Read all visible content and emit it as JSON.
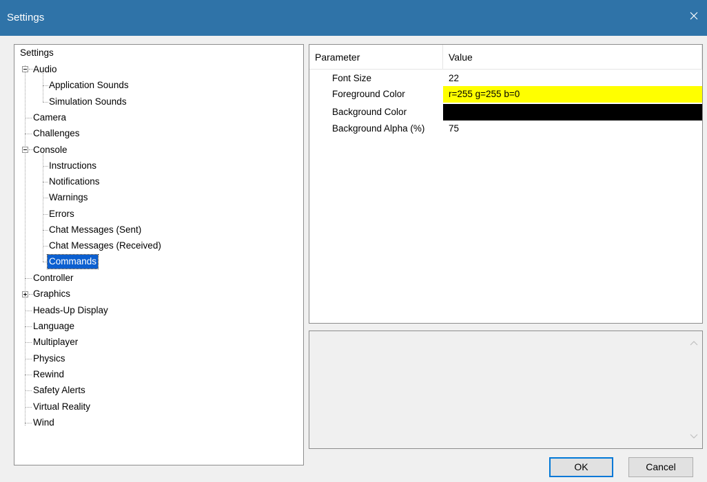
{
  "window": {
    "title": "Settings"
  },
  "tree": {
    "root": "Settings",
    "items": [
      {
        "label": "Audio"
      },
      {
        "label": "Application Sounds"
      },
      {
        "label": "Simulation Sounds"
      },
      {
        "label": "Camera"
      },
      {
        "label": "Challenges"
      },
      {
        "label": "Console"
      },
      {
        "label": "Instructions"
      },
      {
        "label": "Notifications"
      },
      {
        "label": "Warnings"
      },
      {
        "label": "Errors"
      },
      {
        "label": "Chat Messages (Sent)"
      },
      {
        "label": "Chat Messages (Received)"
      },
      {
        "label": "Commands"
      },
      {
        "label": "Controller"
      },
      {
        "label": "Graphics"
      },
      {
        "label": "Heads-Up Display"
      },
      {
        "label": "Language"
      },
      {
        "label": "Multiplayer"
      },
      {
        "label": "Physics"
      },
      {
        "label": "Rewind"
      },
      {
        "label": "Safety Alerts"
      },
      {
        "label": "Virtual Reality"
      },
      {
        "label": "Wind"
      }
    ],
    "selected": "Commands"
  },
  "params": {
    "header_param": "Parameter",
    "header_value": "Value",
    "rows": [
      {
        "name": "Font Size",
        "value": "22"
      },
      {
        "name": "Foreground Color",
        "value": "r=255 g=255 b=0"
      },
      {
        "name": "Background Color",
        "value": ""
      },
      {
        "name": "Background Alpha (%)",
        "value": "75"
      }
    ]
  },
  "colors": {
    "titlebar": "#2f73a8",
    "foreground_swatch": "#ffff00",
    "background_swatch": "#000000",
    "selection": "#0b5fd0"
  },
  "buttons": {
    "ok": "OK",
    "cancel": "Cancel"
  }
}
